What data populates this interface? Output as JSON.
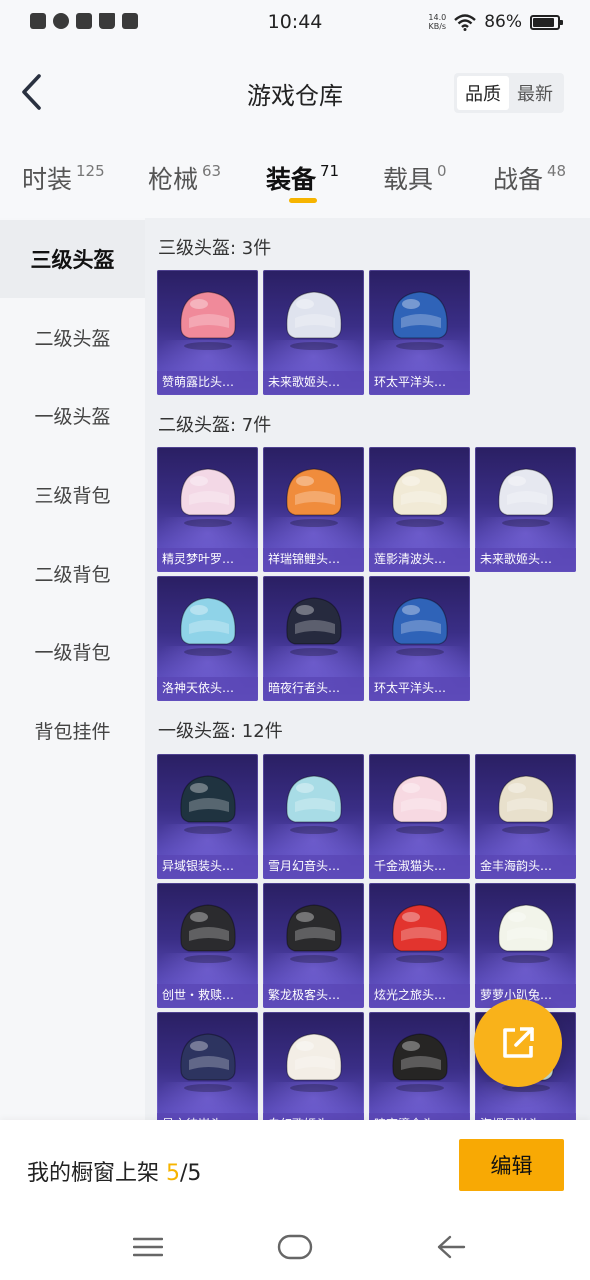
{
  "status_bar": {
    "time": "10:44",
    "net_speed_value": "14.0",
    "net_speed_unit": "KB/s",
    "battery": "86%",
    "battery_level": 0.86,
    "left_icons": [
      "notification-x-icon",
      "notification-circle-icon",
      "notification-image-icon",
      "notification-crown-icon",
      "notification-card-icon"
    ]
  },
  "header": {
    "title": "游戏仓库",
    "sort_options": [
      "品质",
      "最新"
    ],
    "sort_selected": "品质"
  },
  "tabs": [
    {
      "label": "时装",
      "count": "125"
    },
    {
      "label": "枪械",
      "count": "63"
    },
    {
      "label": "装备",
      "count": "71",
      "active": true
    },
    {
      "label": "载具",
      "count": "0"
    },
    {
      "label": "战备",
      "count": "48"
    }
  ],
  "sidebar": {
    "items": [
      "三级头盔",
      "二级头盔",
      "一级头盔",
      "三级背包",
      "二级背包",
      "一级背包",
      "背包挂件"
    ],
    "active": "三级头盔"
  },
  "sections": [
    {
      "title": "三级头盔: 3件",
      "items": [
        {
          "name": "赞萌露比头…",
          "color": "#f08a9a"
        },
        {
          "name": "未来歌姬头…",
          "color": "#dfe3ee"
        },
        {
          "name": "环太平洋头…",
          "color": "#2f63b8"
        }
      ]
    },
    {
      "title": "二级头盔: 7件",
      "items": [
        {
          "name": "精灵梦叶罗…",
          "color": "#f3d8e6"
        },
        {
          "name": "祥瑞锦鲤头…",
          "color": "#f08c3c"
        },
        {
          "name": "莲影清波头…",
          "color": "#f1ead6"
        },
        {
          "name": "未来歌姬头…",
          "color": "#e6e8f0"
        },
        {
          "name": "洛神天依头…",
          "color": "#8fd3e8"
        },
        {
          "name": "暗夜行者头…",
          "color": "#262a3e"
        },
        {
          "name": "环太平洋头…",
          "color": "#2f63b8"
        }
      ]
    },
    {
      "title": "一级头盔: 12件",
      "items": [
        {
          "name": "异域银装头…",
          "color": "#1f3340"
        },
        {
          "name": "雪月幻音头…",
          "color": "#a8dce6"
        },
        {
          "name": "千金淑猫头…",
          "color": "#f7d9e2"
        },
        {
          "name": "金丰海韵头…",
          "color": "#e8e0cc"
        },
        {
          "name": "创世・救赎…",
          "color": "#2b2b2e"
        },
        {
          "name": "繁龙极客头…",
          "color": "#2a2a2c"
        },
        {
          "name": "炫光之旅头…",
          "color": "#e2342e"
        },
        {
          "name": "萝萝小趴兔…",
          "color": "#f2f4ea"
        },
        {
          "name": "星之彼岸头…",
          "color": "#2d3460"
        },
        {
          "name": "白幻歌姬头…",
          "color": "#f3eee6"
        },
        {
          "name": "暗夜鎏金头…",
          "color": "#262524"
        },
        {
          "name": "海螺晨光头…",
          "color": "#cfe9e2"
        }
      ]
    }
  ],
  "fab": {
    "icon": "share-external-icon"
  },
  "bottom_bar": {
    "label": "我的橱窗上架",
    "count_current": "5",
    "count_total": "/5",
    "edit_label": "编辑"
  },
  "nav_bar": {
    "icons": [
      "menu-icon",
      "home-icon",
      "back-icon"
    ]
  },
  "colors": {
    "accent": "#f6b400",
    "card_bg": "#3a2e86"
  }
}
